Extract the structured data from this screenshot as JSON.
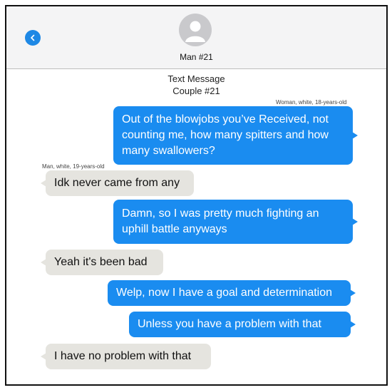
{
  "header": {
    "contact_name": "Man #21",
    "back_icon": "chevron-left-icon",
    "avatar_icon": "person-icon",
    "accent_color": "#1a8cf0"
  },
  "thread": {
    "title_line1": "Text Message",
    "title_line2": "Couple #21"
  },
  "senders": {
    "woman": "Woman, white, 18-years-old",
    "man": "Man, white, 19-years-old"
  },
  "messages": [
    {
      "from": "woman",
      "text": "Out of the blowjobs you’ve Received, not counting me, how many spitters and how many swallowers?"
    },
    {
      "from": "man",
      "text": "Idk never came from any"
    },
    {
      "from": "woman",
      "text": "Damn, so I was pretty much fighting an uphill battle anyways"
    },
    {
      "from": "man",
      "text": "Yeah it's been bad"
    },
    {
      "from": "woman",
      "text": "Welp, now I have a goal and determination"
    },
    {
      "from": "woman",
      "text": "Unless you have a problem with that"
    },
    {
      "from": "man",
      "text": "I have no problem with that"
    }
  ]
}
